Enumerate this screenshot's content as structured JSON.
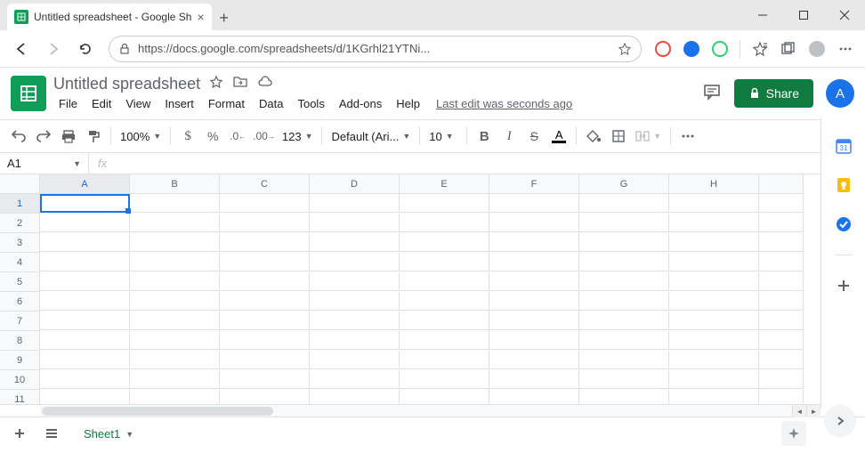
{
  "browser": {
    "tab_title": "Untitled spreadsheet - Google Sh",
    "url": "https://docs.google.com/spreadsheets/d/1KGrhl21YTNi..."
  },
  "header": {
    "doc_title": "Untitled spreadsheet",
    "menus": [
      "File",
      "Edit",
      "View",
      "Insert",
      "Format",
      "Data",
      "Tools",
      "Add-ons",
      "Help"
    ],
    "last_edit": "Last edit was seconds ago",
    "share_label": "Share",
    "avatar_letter": "A"
  },
  "toolbar": {
    "zoom": "100%",
    "font": "Default (Ari...",
    "font_size": "10",
    "number_format": "123",
    "text_color": "#000000",
    "fill_color": "#ffffff"
  },
  "formula_bar": {
    "name_box": "A1",
    "fx": "fx"
  },
  "grid": {
    "columns": [
      "A",
      "B",
      "C",
      "D",
      "E",
      "F",
      "G",
      "H"
    ],
    "rows": [
      1,
      2,
      3,
      4,
      5,
      6,
      7,
      8,
      9,
      10,
      11
    ],
    "selected_cell": "A1"
  },
  "sheet_tabs": {
    "active": "Sheet1"
  },
  "side_panel": {
    "apps": [
      "calendar",
      "keep",
      "tasks"
    ]
  }
}
